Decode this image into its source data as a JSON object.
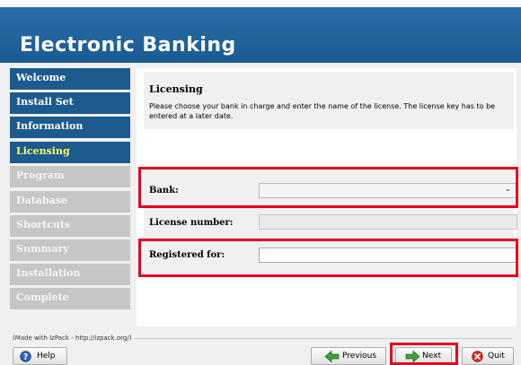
{
  "app": {
    "title": "Electronic Banking"
  },
  "sidebar": {
    "items": [
      {
        "label": "Welcome",
        "state": "done"
      },
      {
        "label": "Install Set",
        "state": "done"
      },
      {
        "label": "Information",
        "state": "done"
      },
      {
        "label": "Licensing",
        "state": "current"
      },
      {
        "label": "Program",
        "state": "todo"
      },
      {
        "label": "Database",
        "state": "todo"
      },
      {
        "label": "Shortcuts",
        "state": "todo"
      },
      {
        "label": "Summary",
        "state": "todo"
      },
      {
        "label": "Installation",
        "state": "todo"
      },
      {
        "label": "Complete",
        "state": "todo"
      }
    ]
  },
  "panel": {
    "heading": "Licensing",
    "description": "Please choose your bank in charge and enter the name of the license. The license key has to be entered at a later date."
  },
  "form": {
    "bank_label": "Bank:",
    "bank_value": "",
    "license_label": "License number:",
    "license_value": "",
    "registered_label": "Registered for:",
    "registered_value": ""
  },
  "footer": {
    "credit": "(Made with IzPack - http://izpack.org/)",
    "help_label": "Help",
    "previous_label": "Previous",
    "next_label": "Next",
    "quit_label": "Quit"
  },
  "colors": {
    "banner": "#1f6098",
    "sidebar_done": "#1d5a8e",
    "sidebar_current_text": "#ffff66",
    "sidebar_todo": "#c6c6c6",
    "highlight": "#e8001c"
  }
}
